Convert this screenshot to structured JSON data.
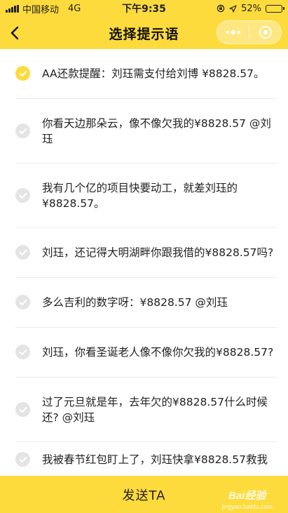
{
  "status_bar": {
    "carrier": "中国移动",
    "network": "4G",
    "time": "下午9:35",
    "battery": "52%",
    "battery_level": 0.52
  },
  "navbar": {
    "title": "选择提示语",
    "back_icon": "chevron-left-icon",
    "more_icon": "more-dots-icon",
    "close_icon": "target-icon"
  },
  "options": [
    {
      "text": "AA还款提醒：刘珏需支付给刘博 ¥8828.57。",
      "selected": true
    },
    {
      "text": "你看天边那朵云，像不像欠我的¥8828.57 @刘珏",
      "selected": false
    },
    {
      "text": "我有几个亿的项目快要动工，就差刘珏的¥8828.57。",
      "selected": false
    },
    {
      "text": "刘珏，还记得大明湖畔你跟我借的¥8828.57吗?",
      "selected": false
    },
    {
      "text": "多么吉利的数字呀：¥8828.57 @刘珏",
      "selected": false
    },
    {
      "text": "刘珏，你看圣诞老人像不像你欠我的¥8828.57?",
      "selected": false
    },
    {
      "text": "过了元旦就是年，去年欠的¥8828.57什么时候还? @刘珏",
      "selected": false
    },
    {
      "text": "我被春节红包盯上了，刘珏快拿¥8828.57救我",
      "selected": false
    }
  ],
  "bottom": {
    "send_label": "发送TA"
  },
  "watermark": {
    "logo": "Bai经验",
    "url": "jingyan.baidu.com"
  },
  "colors": {
    "accent": "#fedb3c",
    "radio_off": "#e4e4e4"
  }
}
